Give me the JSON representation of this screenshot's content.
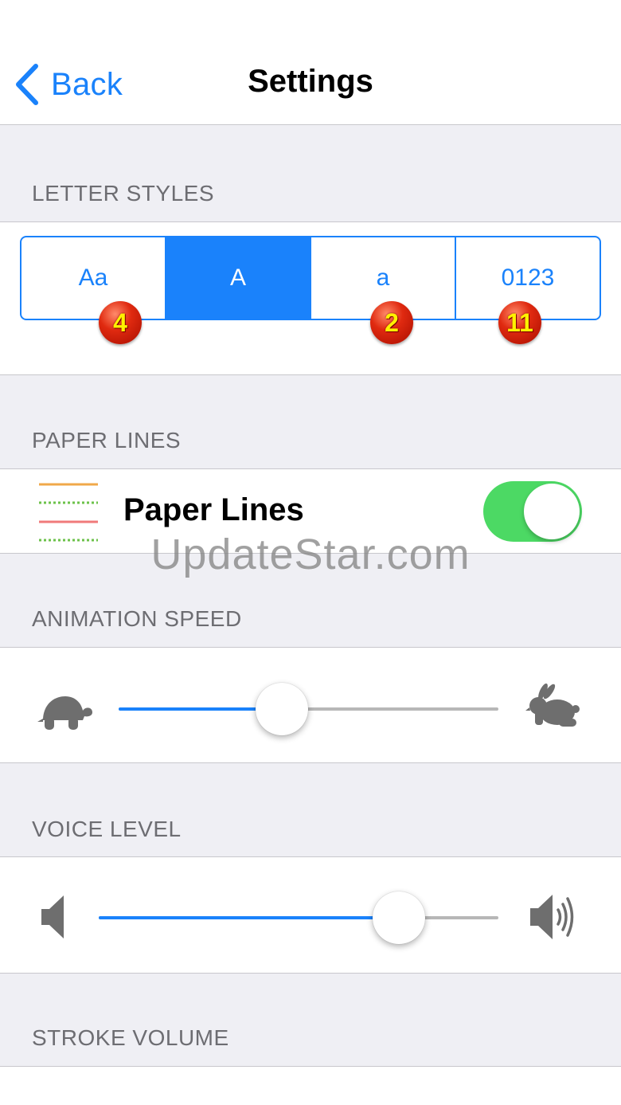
{
  "navbar": {
    "back_label": "Back",
    "title": "Settings"
  },
  "letter_styles": {
    "header": "LETTER STYLES",
    "segments": [
      {
        "label": "Aa",
        "badge": "4"
      },
      {
        "label": "A",
        "badge": ""
      },
      {
        "label": "a",
        "badge": "2"
      },
      {
        "label": "0123",
        "badge": "11"
      }
    ],
    "selected_index": 1
  },
  "paper_lines": {
    "header": "PAPER LINES",
    "label": "Paper Lines",
    "enabled": true
  },
  "watermark": "UpdateStar.com",
  "animation_speed": {
    "header": "ANIMATION SPEED",
    "value": 0.43,
    "min_icon": "turtle-icon",
    "max_icon": "rabbit-icon"
  },
  "voice_level": {
    "header": "VOICE LEVEL",
    "value": 0.75,
    "min_icon": "speaker-low-icon",
    "max_icon": "speaker-high-icon"
  },
  "stroke_volume": {
    "header": "STROKE VOLUME"
  },
  "colors": {
    "accent": "#1a82fb",
    "toggle_on": "#4cd964",
    "background": "#efeff4",
    "header_text": "#6d6d72",
    "badge": "#e02a10",
    "badge_text": "#fff200"
  }
}
